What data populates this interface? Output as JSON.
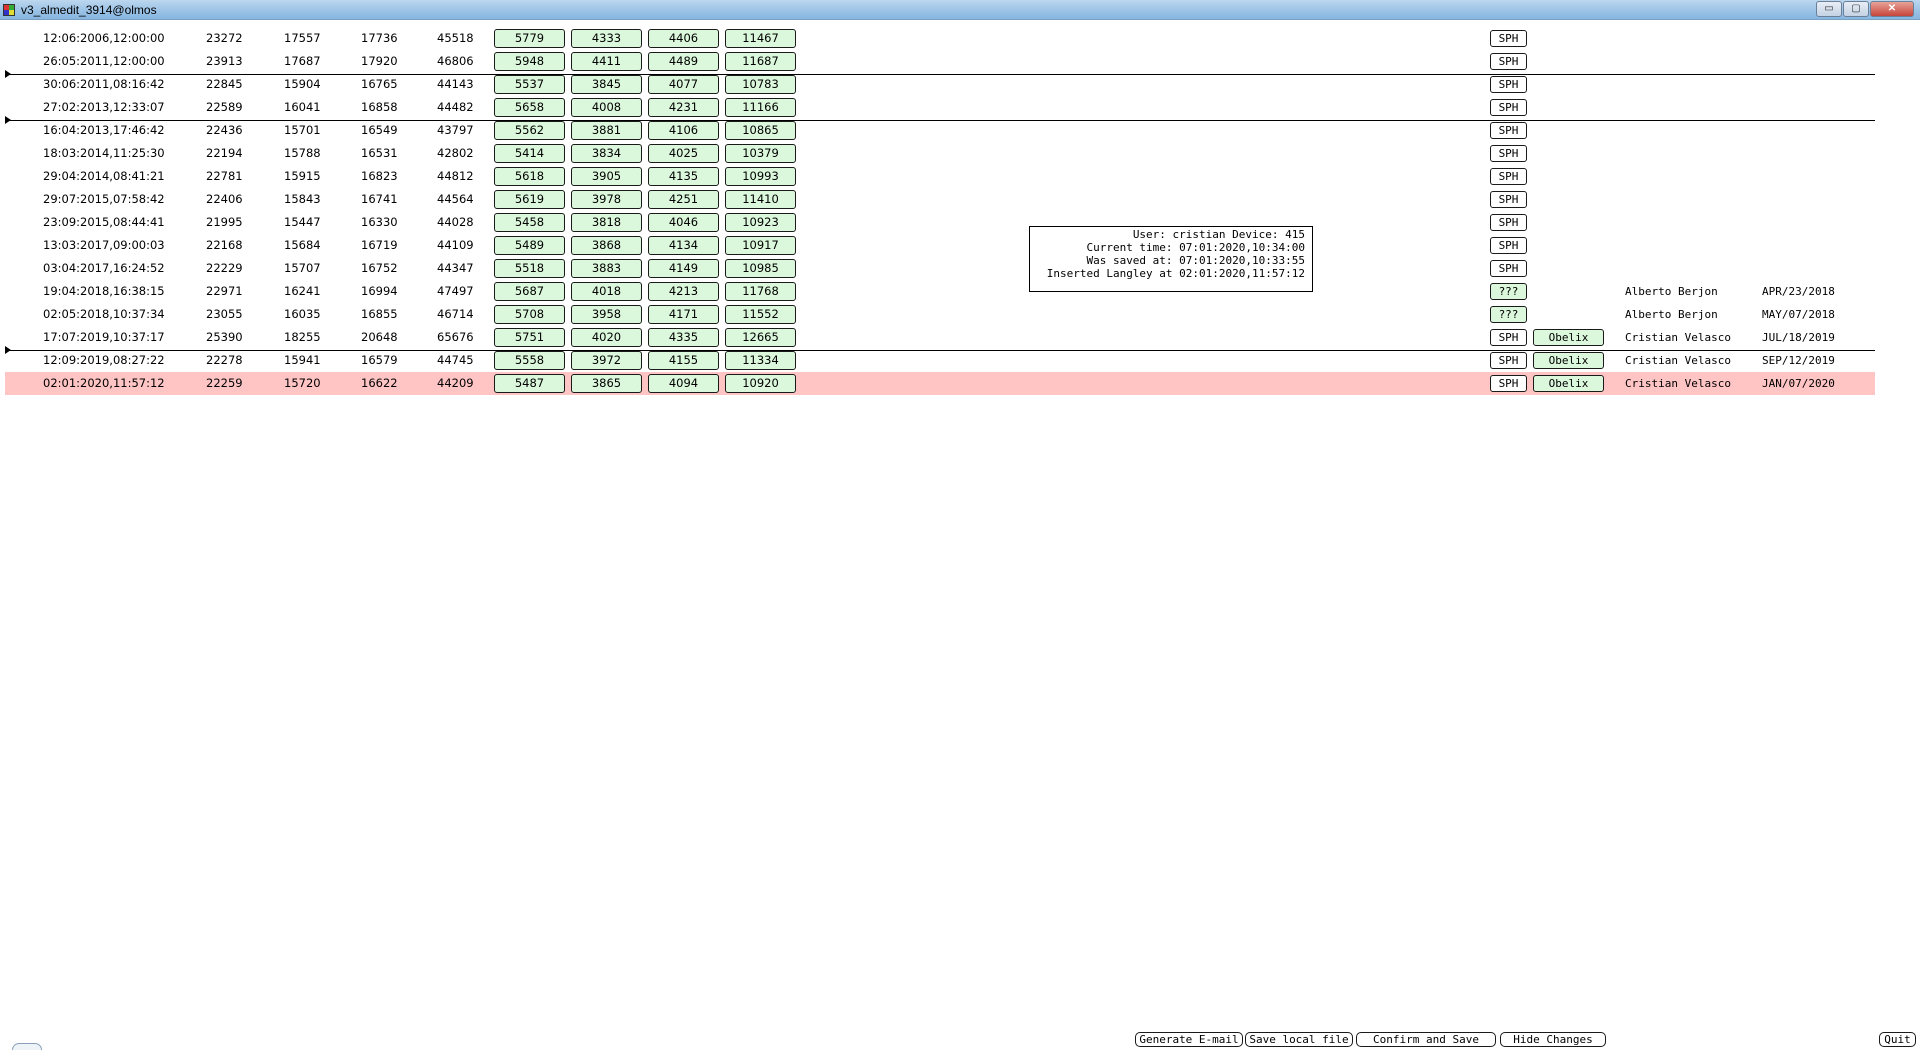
{
  "window": {
    "title": "v3_almedit_3914@olmos",
    "minimize_label": "▭",
    "maximize_label": "▢",
    "close_label": "✕"
  },
  "rows": [
    {
      "date": "12:06:2006,12:00:00",
      "n1": "23272",
      "n2": "17557",
      "n3": "17736",
      "n4": "45518",
      "g1": "5779",
      "g2": "4333",
      "g3": "4406",
      "g4": "11467",
      "tag": "SPH",
      "obelix": "",
      "user": "",
      "user_date": ""
    },
    {
      "date": "26:05:2011,12:00:00",
      "n1": "23913",
      "n2": "17687",
      "n3": "17920",
      "n4": "46806",
      "g1": "5948",
      "g2": "4411",
      "g3": "4489",
      "g4": "11687",
      "tag": "SPH",
      "obelix": "",
      "user": "",
      "user_date": ""
    },
    {
      "date": "30:06:2011,08:16:42",
      "n1": "22845",
      "n2": "15904",
      "n3": "16765",
      "n4": "44143",
      "g1": "5537",
      "g2": "3845",
      "g3": "4077",
      "g4": "10783",
      "tag": "SPH",
      "obelix": "",
      "user": "",
      "user_date": ""
    },
    {
      "date": "27:02:2013,12:33:07",
      "n1": "22589",
      "n2": "16041",
      "n3": "16858",
      "n4": "44482",
      "g1": "5658",
      "g2": "4008",
      "g3": "4231",
      "g4": "11166",
      "tag": "SPH",
      "obelix": "",
      "user": "",
      "user_date": ""
    },
    {
      "date": "16:04:2013,17:46:42",
      "n1": "22436",
      "n2": "15701",
      "n3": "16549",
      "n4": "43797",
      "g1": "5562",
      "g2": "3881",
      "g3": "4106",
      "g4": "10865",
      "tag": "SPH",
      "obelix": "",
      "user": "",
      "user_date": ""
    },
    {
      "date": "18:03:2014,11:25:30",
      "n1": "22194",
      "n2": "15788",
      "n3": "16531",
      "n4": "42802",
      "g1": "5414",
      "g2": "3834",
      "g3": "4025",
      "g4": "10379",
      "tag": "SPH",
      "obelix": "",
      "user": "",
      "user_date": ""
    },
    {
      "date": "29:04:2014,08:41:21",
      "n1": "22781",
      "n2": "15915",
      "n3": "16823",
      "n4": "44812",
      "g1": "5618",
      "g2": "3905",
      "g3": "4135",
      "g4": "10993",
      "tag": "SPH",
      "obelix": "",
      "user": "",
      "user_date": ""
    },
    {
      "date": "29:07:2015,07:58:42",
      "n1": "22406",
      "n2": "15843",
      "n3": "16741",
      "n4": "44564",
      "g1": "5619",
      "g2": "3978",
      "g3": "4251",
      "g4": "11410",
      "tag": "SPH",
      "obelix": "",
      "user": "",
      "user_date": ""
    },
    {
      "date": "23:09:2015,08:44:41",
      "n1": "21995",
      "n2": "15447",
      "n3": "16330",
      "n4": "44028",
      "g1": "5458",
      "g2": "3818",
      "g3": "4046",
      "g4": "10923",
      "tag": "SPH",
      "obelix": "",
      "user": "",
      "user_date": ""
    },
    {
      "date": "13:03:2017,09:00:03",
      "n1": "22168",
      "n2": "15684",
      "n3": "16719",
      "n4": "44109",
      "g1": "5489",
      "g2": "3868",
      "g3": "4134",
      "g4": "10917",
      "tag": "SPH",
      "obelix": "",
      "user": "",
      "user_date": ""
    },
    {
      "date": "03:04:2017,16:24:52",
      "n1": "22229",
      "n2": "15707",
      "n3": "16752",
      "n4": "44347",
      "g1": "5518",
      "g2": "3883",
      "g3": "4149",
      "g4": "10985",
      "tag": "SPH",
      "obelix": "",
      "user": "",
      "user_date": ""
    },
    {
      "date": "19:04:2018,16:38:15",
      "n1": "22971",
      "n2": "16241",
      "n3": "16994",
      "n4": "47497",
      "g1": "5687",
      "g2": "4018",
      "g3": "4213",
      "g4": "11768",
      "tag": "???",
      "obelix": "",
      "user": "Alberto Berjon",
      "user_date": "APR/23/2018"
    },
    {
      "date": "02:05:2018,10:37:34",
      "n1": "23055",
      "n2": "16035",
      "n3": "16855",
      "n4": "46714",
      "g1": "5708",
      "g2": "3958",
      "g3": "4171",
      "g4": "11552",
      "tag": "???",
      "obelix": "",
      "user": "Alberto Berjon",
      "user_date": "MAY/07/2018"
    },
    {
      "date": "17:07:2019,10:37:17",
      "n1": "25390",
      "n2": "18255",
      "n3": "20648",
      "n4": "65676",
      "g1": "5751",
      "g2": "4020",
      "g3": "4335",
      "g4": "12665",
      "tag": "SPH",
      "obelix": "Obelix",
      "user": "Cristian Velasco",
      "user_date": "JUL/18/2019"
    },
    {
      "date": "12:09:2019,08:27:22",
      "n1": "22278",
      "n2": "15941",
      "n3": "16579",
      "n4": "44745",
      "g1": "5558",
      "g2": "3972",
      "g3": "4155",
      "g4": "11334",
      "tag": "SPH",
      "obelix": "Obelix",
      "user": "Cristian Velasco",
      "user_date": "SEP/12/2019"
    },
    {
      "date": "02:01:2020,11:57:12",
      "n1": "22259",
      "n2": "15720",
      "n3": "16622",
      "n4": "44209",
      "g1": "5487",
      "g2": "3865",
      "g3": "4094",
      "g4": "10920",
      "tag": "SPH",
      "obelix": "Obelix",
      "user": "Cristian Velasco",
      "user_date": "JAN/07/2020"
    }
  ],
  "info": {
    "line1": "User: cristian Device: 415",
    "line2": "Current time: 07:01:2020,10:34:00",
    "line3": "Was saved at: 07:01:2020,10:33:55",
    "line4": "Inserted Langley at 02:01:2020,11:57:12"
  },
  "actions": {
    "generate_email": "Generate E-mail",
    "save_local": "Save local file",
    "confirm_save": "Confirm and Save",
    "hide_changes": "Hide Changes",
    "quit": "Quit"
  }
}
